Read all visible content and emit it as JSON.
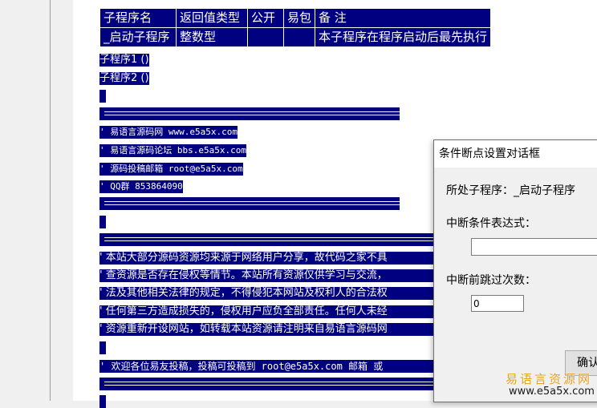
{
  "table": {
    "headers": [
      "子程序名",
      "返回值类型",
      "公开",
      "易包",
      "备 注"
    ],
    "row": [
      "_启动子程序",
      "整数型",
      "",
      "",
      "本子程序在程序启动后最先执行"
    ]
  },
  "code": {
    "sub1": "子程序1 ()",
    "sub2": "子程序2 ()",
    "site": "' 易语言源码网    www.e5a5x.com",
    "forum": "' 易语言源码论坛    bbs.e5a5x.com",
    "email": "' 源码投稿邮箱  root@e5a5x.com",
    "qq": "' QQ群    853864090",
    "notice1": "' 本站大部分源码资源均来源于网络用户分享，故代码之家不具",
    "notice2": "' 查资源是否存在侵权等情节。本站所有资源仅供学习与交流，",
    "notice3": "' 法及其他相关法律的规定，不得侵犯本网站及权利人的合法权",
    "notice4": "' 任何第三方造成损失的，侵权用户应负全部责任。任何人未经",
    "notice5": "' 资源重新开设网站，如转载本站资源请注明来自易语言源码网",
    "welcome": "' 欢迎各位易友投稿，投稿可投稿到    root@e5a5x.com  邮箱 或"
  },
  "dialog": {
    "title": "条件断点设置对话框",
    "location_label": "所处子程序：_启动子程序",
    "condition_label": "中断条件表达式：",
    "condition_value": "",
    "skip_label": "中断前跳过次数：",
    "skip_value": "0",
    "ok_label": "确认"
  },
  "watermark": {
    "name": "易语言资源网",
    "url": "www.e5a5x.com"
  }
}
